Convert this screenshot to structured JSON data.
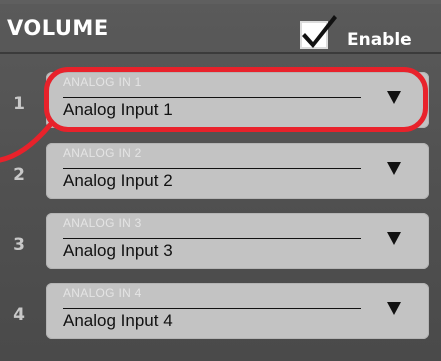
{
  "header": {
    "title": "VOLUME",
    "enable_label": "Enable",
    "enable_checked": true
  },
  "inputs": [
    {
      "number": "1",
      "small_label": "ANALOG IN 1",
      "value": "Analog Input 1"
    },
    {
      "number": "2",
      "small_label": "ANALOG IN 2",
      "value": "Analog Input 2"
    },
    {
      "number": "3",
      "small_label": "ANALOG IN 3",
      "value": "Analog Input 3"
    },
    {
      "number": "4",
      "small_label": "ANALOG IN 4",
      "value": "Analog Input 4"
    }
  ],
  "colors": {
    "panel": "#4f4f4f",
    "dropdown": "#c3c3c3",
    "highlight": "#e8222b"
  },
  "icons": {
    "checkbox": "checkmark-icon",
    "dropdown": "dropdown-arrow-icon"
  }
}
